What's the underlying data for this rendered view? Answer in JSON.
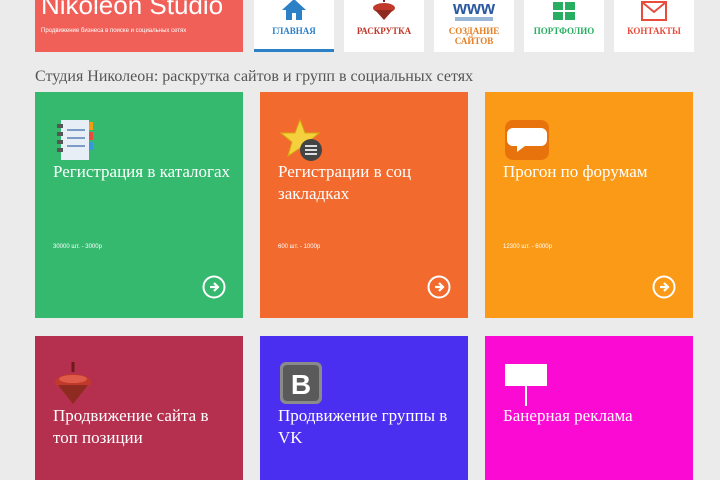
{
  "logo": {
    "title": "Nikoleon Studio",
    "subtitle": "Продвижение бизнеса в поиске и социальных сетях",
    "color": "#f06058"
  },
  "nav": [
    {
      "label": "ГЛАВНАЯ",
      "icon": "home-icon",
      "color": "#2b80c6",
      "active": true
    },
    {
      "label": "РАСКРУТКА",
      "icon": "spinning-top-icon",
      "color": "#c0392b"
    },
    {
      "label": "СОЗДАНИЕ САЙТОВ",
      "icon": "www-icon",
      "color": "#e67e22"
    },
    {
      "label": "ПОРТФОЛИО",
      "icon": "grid-icon",
      "color": "#27ae60"
    },
    {
      "label": "КОНТАКТЫ",
      "icon": "mail-icon",
      "color": "#e74c3c"
    }
  ],
  "heading": "Студия Николеон: раскрутка сайтов и групп в социальных сетях",
  "tiles": [
    {
      "title": "Регистрация в каталогах",
      "price": "30000 шт. - 3000р",
      "color": "#34b96e",
      "icon": "notebook-icon"
    },
    {
      "title": "Регистрации в соц закладках",
      "price": "600 шт. - 1000р",
      "color": "#f26a2e",
      "icon": "star-icon"
    },
    {
      "title": "Прогон по форумам",
      "price": "12300 шт. - 6000р",
      "color": "#fa9a16",
      "icon": "speech-bubble-icon"
    },
    {
      "title": "Продвижение сайта в топ позиции",
      "price": "",
      "color": "#b5304f",
      "icon": "spinning-top-icon"
    },
    {
      "title": "Продвижение группы в VK",
      "price": "",
      "color": "#4a2ff0",
      "icon": "vk-icon"
    },
    {
      "title": "Банерная реклама",
      "price": "",
      "color": "#fb0ad4",
      "icon": "banner-icon"
    }
  ]
}
